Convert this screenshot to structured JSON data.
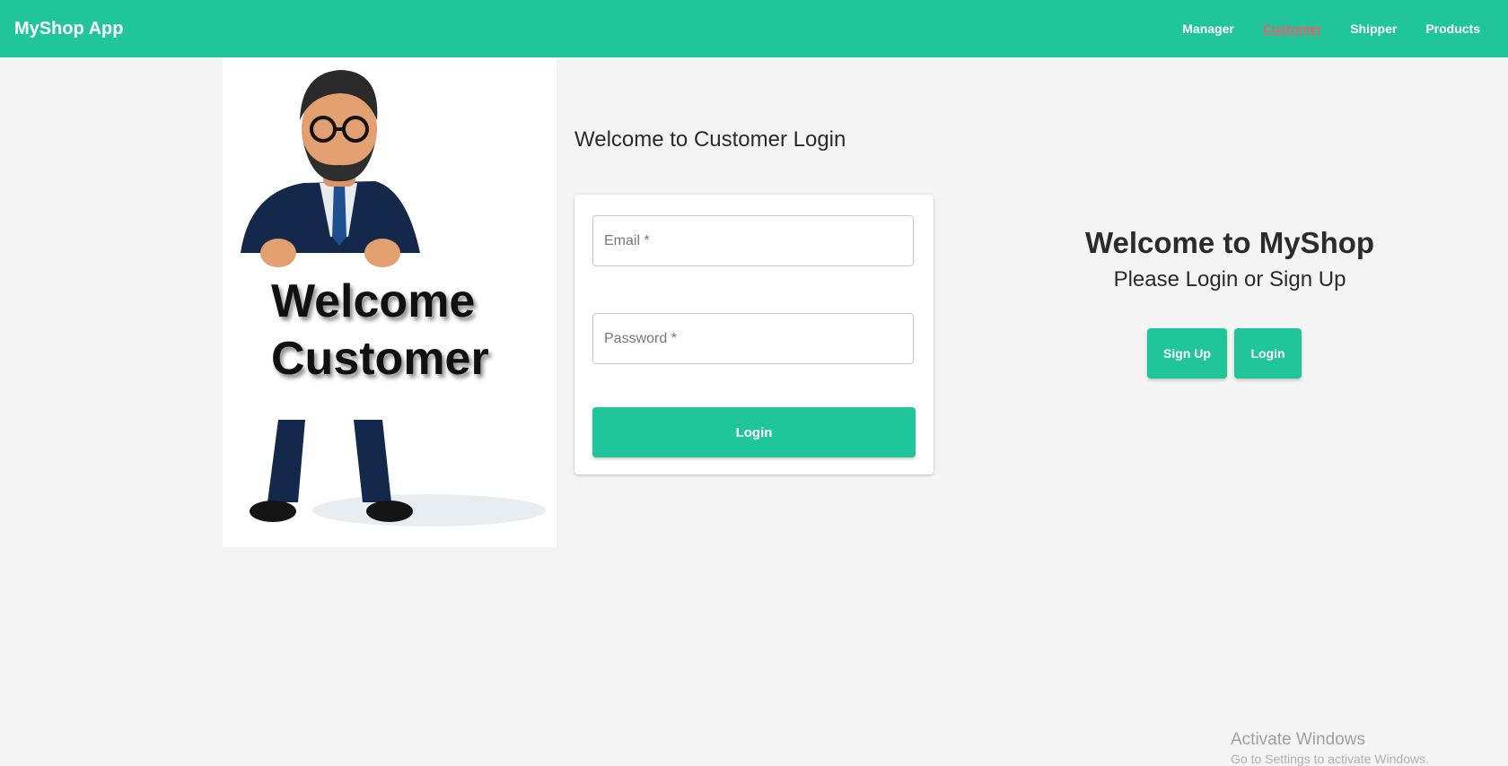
{
  "header": {
    "brand": "MyShop App",
    "nav": [
      "Manager",
      "Customer",
      "Shipper",
      "Products"
    ],
    "active_nav": "Customer",
    "accent_color": "#20c69a",
    "active_color": "#f05c6e"
  },
  "hero": {
    "title_line1": "Welcome",
    "title_line2": "Customer"
  },
  "login": {
    "heading": "Welcome to Customer Login",
    "email_placeholder": "Email *",
    "password_placeholder": "Password *",
    "submit_label": "Login"
  },
  "welcome_panel": {
    "title": "Welcome to MyShop",
    "subtitle": "Please Login or Sign Up",
    "signup_label": "Sign Up",
    "login_label": "Login"
  },
  "os_overlay": {
    "watermark": "Activate Windows",
    "watermark_sub": "Go to Settings to activate Windows."
  }
}
